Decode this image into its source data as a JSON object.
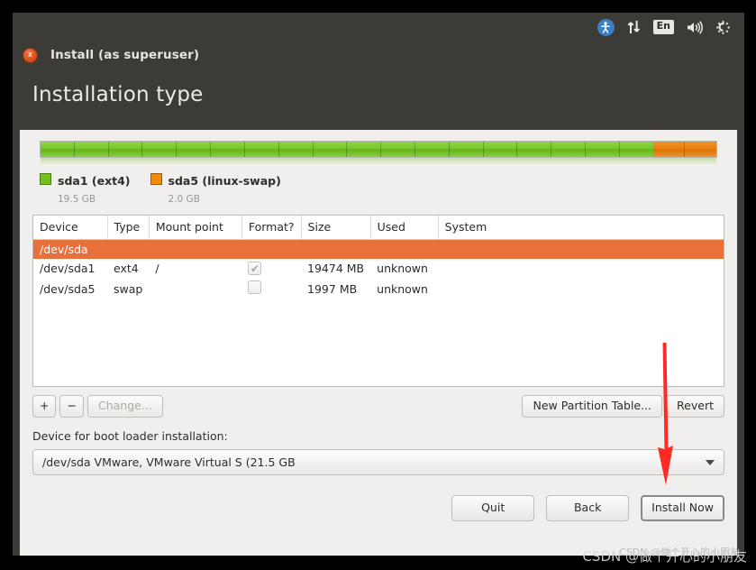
{
  "panel": {
    "icons": [
      {
        "name": "accessibility-icon",
        "glyph": "\u0000"
      },
      {
        "name": "network-icon",
        "glyph": "↑↓"
      },
      {
        "name": "keyboard-layout-indicator",
        "glyph": "En"
      },
      {
        "name": "volume-icon",
        "glyph": "🔊"
      },
      {
        "name": "system-menu-icon",
        "glyph": "⚙"
      }
    ]
  },
  "window": {
    "title": "Install (as superuser)",
    "close_glyph": "x",
    "page_title": "Installation type"
  },
  "partition_bar": {
    "segments": [
      {
        "label": "sda1 (ext4)",
        "color": "#73c11c",
        "percent": 90.6
      },
      {
        "label": "sda5 (linux-swap)",
        "color": "#ef8d0a",
        "percent": 9.4
      }
    ]
  },
  "legend": [
    {
      "name": "sda1 (ext4)",
      "size": "19.5 GB",
      "color": "#73c11c"
    },
    {
      "name": "sda5 (linux-swap)",
      "size": "2.0 GB",
      "color": "#ef8d0a"
    }
  ],
  "table": {
    "headers": [
      "Device",
      "Type",
      "Mount point",
      "Format?",
      "Size",
      "Used",
      "System"
    ],
    "rows": [
      {
        "kind": "disk",
        "device": "/dev/sda",
        "type": "",
        "mount": "",
        "format": null,
        "size": "",
        "used": "",
        "system": ""
      },
      {
        "kind": "partition",
        "device": "/dev/sda1",
        "type": "ext4",
        "mount": "/",
        "format": true,
        "size": "19474 MB",
        "used": "unknown",
        "system": ""
      },
      {
        "kind": "partition",
        "device": "/dev/sda5",
        "type": "swap",
        "mount": "",
        "format": false,
        "size": "1997 MB",
        "used": "unknown",
        "system": ""
      }
    ],
    "checkbox_checked_glyph": "✔"
  },
  "edit_toolbar": {
    "add_label": "+",
    "remove_label": "−",
    "change_label": "Change...",
    "new_partition_table_label": "New Partition Table...",
    "revert_label": "Revert"
  },
  "bootloader": {
    "label": "Device for boot loader installation:",
    "value": "/dev/sda   VMware, VMware Virtual S (21.5 GB"
  },
  "actions": {
    "quit_label": "Quit",
    "back_label": "Back",
    "install_label": "Install Now"
  },
  "annotation": {
    "arrow_color": "#fc2b24",
    "points_to": "Install Now"
  },
  "watermark": {
    "text": "CSDN @做个开心的小朋友",
    "ghost_text": "CSDN @做个开心的小朋友"
  }
}
